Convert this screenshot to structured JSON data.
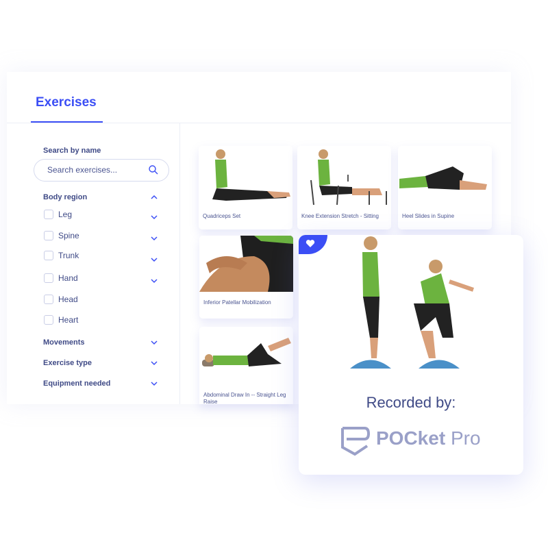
{
  "tabs": [
    {
      "label": "Exercises",
      "active": true
    }
  ],
  "sidebar": {
    "search_label": "Search by name",
    "search_placeholder": "Search exercises...",
    "body_region": {
      "label": "Body region",
      "expanded": true,
      "items": [
        {
          "label": "Leg",
          "expandable": true
        },
        {
          "label": "Spine",
          "expandable": true
        },
        {
          "label": "Trunk",
          "expandable": true
        },
        {
          "label": "Hand",
          "expandable": true
        },
        {
          "label": "Head",
          "expandable": false
        },
        {
          "label": "Heart",
          "expandable": false
        }
      ]
    },
    "sections": [
      {
        "label": "Movements"
      },
      {
        "label": "Exercise type"
      },
      {
        "label": "Equipment needed"
      }
    ]
  },
  "exercises": [
    {
      "title": "Quadriceps Set"
    },
    {
      "title": "Knee Extension Stretch - Sitting"
    },
    {
      "title": "Heel Slides in Supine"
    },
    {
      "title": "Inferior Patellar Mobilization"
    },
    {
      "title": "Abdominal Draw In -- Straight Leg Raise"
    }
  ],
  "featured": {
    "favorite_icon": "heart-icon",
    "recorded_by": "Recorded by:",
    "brand": "POCket Pro",
    "brand_bold": "POCket",
    "brand_light": "Pro"
  },
  "colors": {
    "accent": "#3b4ef5",
    "text": "#3f4a86",
    "shirt": "#6cb33f"
  }
}
